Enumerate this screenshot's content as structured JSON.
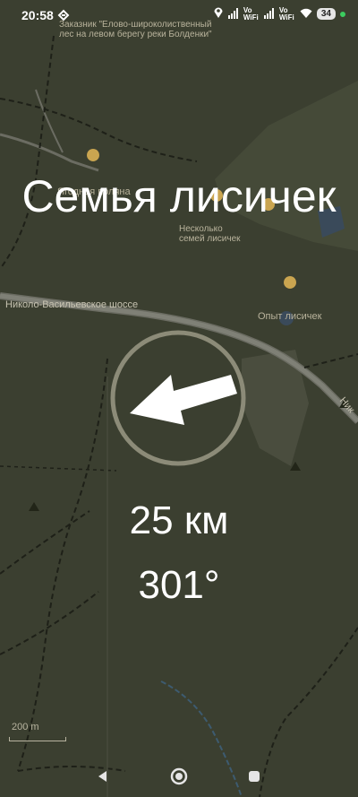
{
  "status_bar": {
    "time": "20:58",
    "network_label_1": "Vo WiFi",
    "network_label_2": "Vo WiFi",
    "battery": "34",
    "icons": [
      "arrow-icon",
      "location-icon",
      "signal-icon",
      "wifi-icon",
      "battery-icon"
    ]
  },
  "map": {
    "labels": [
      "Заказник \"Елово-широколиственный лес на левом берегу реки Болденки\"",
      "Ягодная поляна",
      "Несколько семей лисичек",
      "Опыт лисичек",
      "Николо-Васильевское шоссе",
      "Ник"
    ]
  },
  "target": {
    "name": "Семья лисичек",
    "distance": "25 км",
    "bearing": "301°"
  },
  "scale_bar": {
    "label": "200 m"
  },
  "colors": {
    "map_bg": "#3b3f30",
    "text": "#ffffff",
    "compass_ring": "#8c8b78"
  }
}
